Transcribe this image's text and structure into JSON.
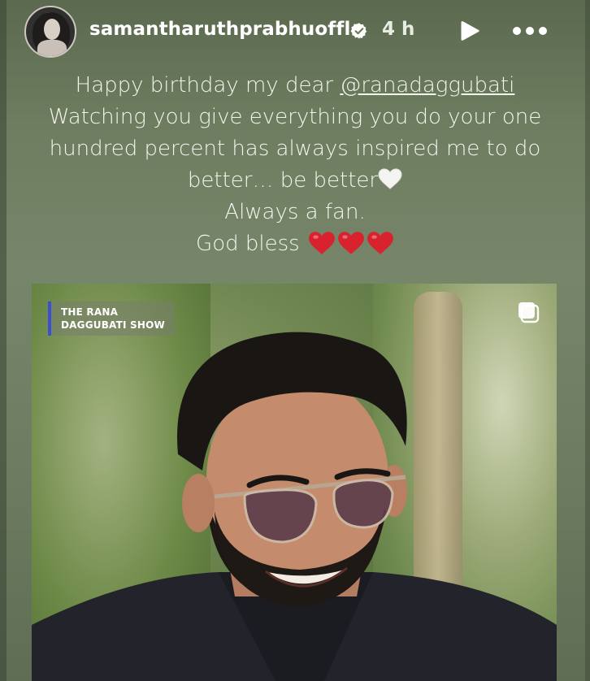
{
  "post": {
    "username": "samantharuthprabhuoffl",
    "time": "4 h",
    "caption_lines": [
      "Happy birthday my dear ",
      "Watching you give everything you do your one",
      "hundred percent has always inspired me to do",
      "better… be better",
      "Always a fan.",
      "God bless "
    ],
    "mention": "@ranadaggubati"
  },
  "media": {
    "show_label_line1": "THE RANA",
    "show_label_line2": "DAGGUBATI SHOW"
  },
  "icons": {
    "verified": "verified-badge-icon",
    "play": "play-icon",
    "more": "more-options-icon",
    "white_heart": "white-heart-emoji",
    "red_heart": "red-heart-emoji",
    "multi": "multiple-images-icon"
  },
  "colors": {
    "background": "#6e7c5f",
    "label_accent": "#3a4fd6",
    "heart_red": "#d8232f"
  }
}
